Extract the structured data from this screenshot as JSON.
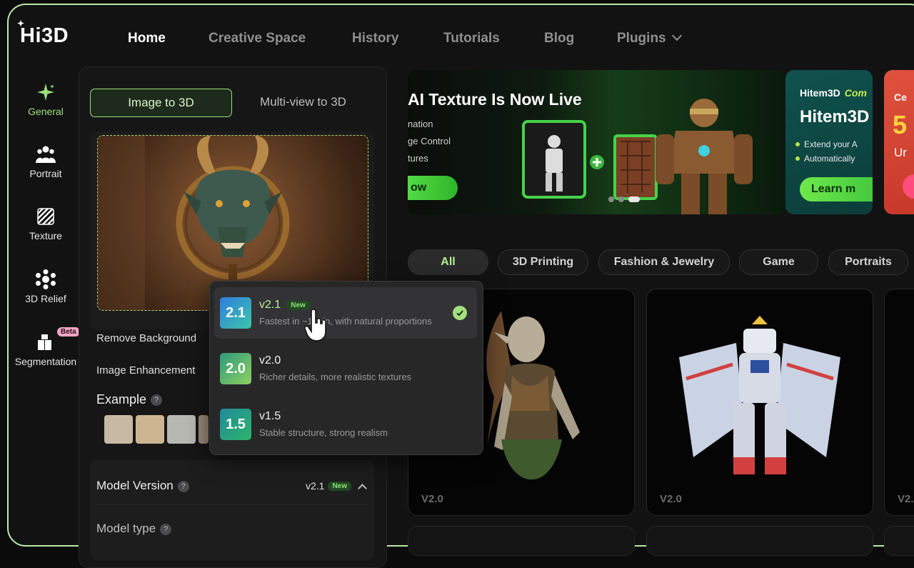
{
  "app": {
    "logo": "Hi3D"
  },
  "nav": {
    "items": [
      {
        "label": "Home",
        "active": true
      },
      {
        "label": "Creative Space"
      },
      {
        "label": "History"
      },
      {
        "label": "Tutorials"
      },
      {
        "label": "Blog"
      },
      {
        "label": "Plugins",
        "has_dropdown": true
      }
    ]
  },
  "sidebar": {
    "items": [
      {
        "label": "General",
        "icon": "sparkle-icon",
        "active": true
      },
      {
        "label": "Portrait",
        "icon": "people-icon"
      },
      {
        "label": "Texture",
        "icon": "texture-icon"
      },
      {
        "label": "3D Relief",
        "icon": "relief-icon"
      },
      {
        "label": "Segmentation",
        "icon": "segmentation-icon",
        "badge": "Beta"
      }
    ]
  },
  "panel": {
    "tabs": [
      "Image to 3D",
      "Multi-view to 3D"
    ],
    "remove_background": "Remove Background",
    "image_enhancement": "Image Enhancement",
    "example": "Example",
    "help": "?",
    "model_version": {
      "title": "Model Version",
      "value": "v2.1",
      "badge": "New"
    },
    "model_type": "Model type"
  },
  "dropdown": {
    "options": [
      {
        "badge": "2.1",
        "name": "v2.1",
        "tag": "New",
        "desc": "Fastest in ~1 min, with natural proportions",
        "selected": true
      },
      {
        "badge": "2.0",
        "name": "v2.0",
        "desc": "Richer details, more realistic textures"
      },
      {
        "badge": "1.5",
        "name": "v1.5",
        "desc": "Stable structure, strong realism"
      }
    ]
  },
  "banners": {
    "b1": {
      "title": "AI Texture Is Now Live",
      "lines": [
        "nation",
        "ge Control",
        "tures"
      ],
      "button": "ow"
    },
    "b2": {
      "logo": "Hitem3D",
      "logo_tag": "Com",
      "title": "Hitem3D",
      "items": [
        "Extend your A",
        "Automatically"
      ],
      "button": "Learn m"
    },
    "b3": {
      "line1": "Ce",
      "line2": "5",
      "line3": "Ur"
    }
  },
  "filters": [
    "All",
    "3D Printing",
    "Fashion & Jewelry",
    "Game",
    "Portraits"
  ],
  "cards": [
    {
      "label": "V2.0"
    },
    {
      "label": "V2.0"
    },
    {
      "label": "V2."
    }
  ],
  "colors": {
    "accent": "#9be07a",
    "frame": "#b9e8a6",
    "bg": "#121213"
  }
}
